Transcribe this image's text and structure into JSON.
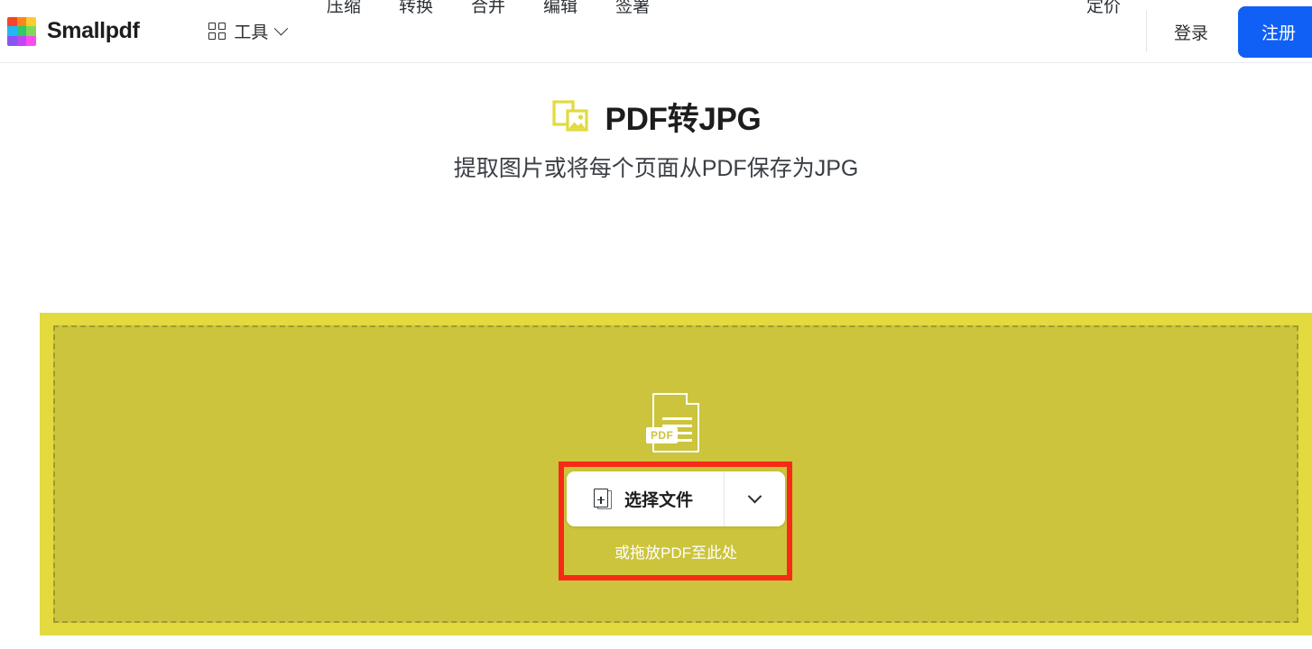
{
  "header": {
    "brand": {
      "name": "Smallpdf",
      "logo_icon": "smallpdf-logo-grid",
      "logo_colors": [
        "#f8442a",
        "#fd8620",
        "#fdcc2e",
        "#23b7f5",
        "#2ec96a",
        "#7ed957",
        "#8a54f0",
        "#c045f5",
        "#fb4df0"
      ]
    },
    "tools_menu": {
      "icon": "grid-icon",
      "label": "工具",
      "chevron": "chevron-down-icon"
    },
    "nav_items": [
      {
        "label": "压缩"
      },
      {
        "label": "转换"
      },
      {
        "label": "合并"
      },
      {
        "label": "编辑"
      },
      {
        "label": "签署"
      }
    ],
    "pricing_label": "定价",
    "login_label": "登录",
    "signup_label": "注册",
    "signup_color": "#1060f5"
  },
  "hero": {
    "icon": "pdf-to-image-icon",
    "icon_color": "#e2da3e",
    "title": "PDF转JPG",
    "subtitle": "提取图片或将每个页面从PDF保存为JPG"
  },
  "dropzone": {
    "outer_color": "#e2da3e",
    "inner_color": "#ccc43c",
    "dashed_border_color": "#9e9a33",
    "file_icon": "pdf-document-icon",
    "file_icon_badge": "PDF",
    "choose_file_label": "选择文件",
    "choose_file_icon": "file-plus-icon",
    "dropdown_icon": "chevron-down-icon",
    "drag_hint": "或拖放PDF至此处"
  },
  "annotation": {
    "highlight_color": "#f72a18"
  }
}
